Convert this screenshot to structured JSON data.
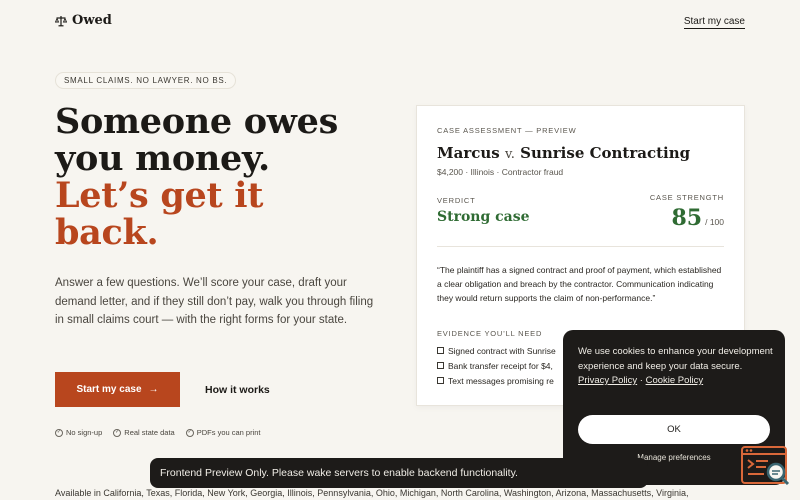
{
  "header": {
    "logo_text": "Owed",
    "cta": "Start my case"
  },
  "hero": {
    "tag": "SMALL CLAIMS. NO LAWYER. NO BS.",
    "headline_line1": "Someone owes",
    "headline_line2": "you money.",
    "headline_line3": "Let’s get it",
    "headline_line4": "back.",
    "lede": "Answer a few questions. We’ll score your case, draft your demand letter, and if they still don’t pay, walk you through filing in small claims court — with the right forms for your state.",
    "primary_button": "Start my case",
    "primary_arrow": "→",
    "secondary_button": "How it works",
    "features": [
      "No sign-up",
      "Real state data",
      "PDFs you can print"
    ],
    "states": "Available in California, Texas, Florida, New York, Georgia, Illinois, Pennsylvania, Ohio, Michigan, North Carolina, Washington, Arizona, Massachusetts, Virginia,"
  },
  "card": {
    "eyebrow": "CASE ASSESSMENT — PREVIEW",
    "plaintiff": "Marcus",
    "vs": "v.",
    "defendant": "Sunrise Contracting",
    "meta": "$4,200 · Illinois · Contractor fraud",
    "verdict_label": "VERDICT",
    "verdict_value": "Strong case",
    "strength_label": "CASE STRENGTH",
    "strength_value": "85",
    "strength_max": "/ 100",
    "quote": "“The plaintiff has a signed contract and proof of payment, which established a clear obligation and breach by the contractor. Communication indicating they would return supports the claim of non-performance.”",
    "evidence_label": "EVIDENCE YOU’LL NEED",
    "evidence": [
      "Signed contract with Sunrise",
      "Bank transfer receipt for $4,",
      "Text messages promising re"
    ]
  },
  "cookie": {
    "text": "We use cookies to enhance your development experience and keep your data secure.",
    "privacy_link": "Privacy Policy",
    "separator": "·",
    "cookie_link": "Cookie Policy",
    "ok": "OK",
    "manage": "Manage preferences"
  },
  "toast": {
    "text": "Frontend Preview Only. Please wake servers to enable backend functionality."
  },
  "colors": {
    "accent": "#b8461e",
    "success": "#2f6b33",
    "background": "#f7f5f0",
    "dark": "#1d1b19",
    "float_icon": "#d9683a"
  }
}
